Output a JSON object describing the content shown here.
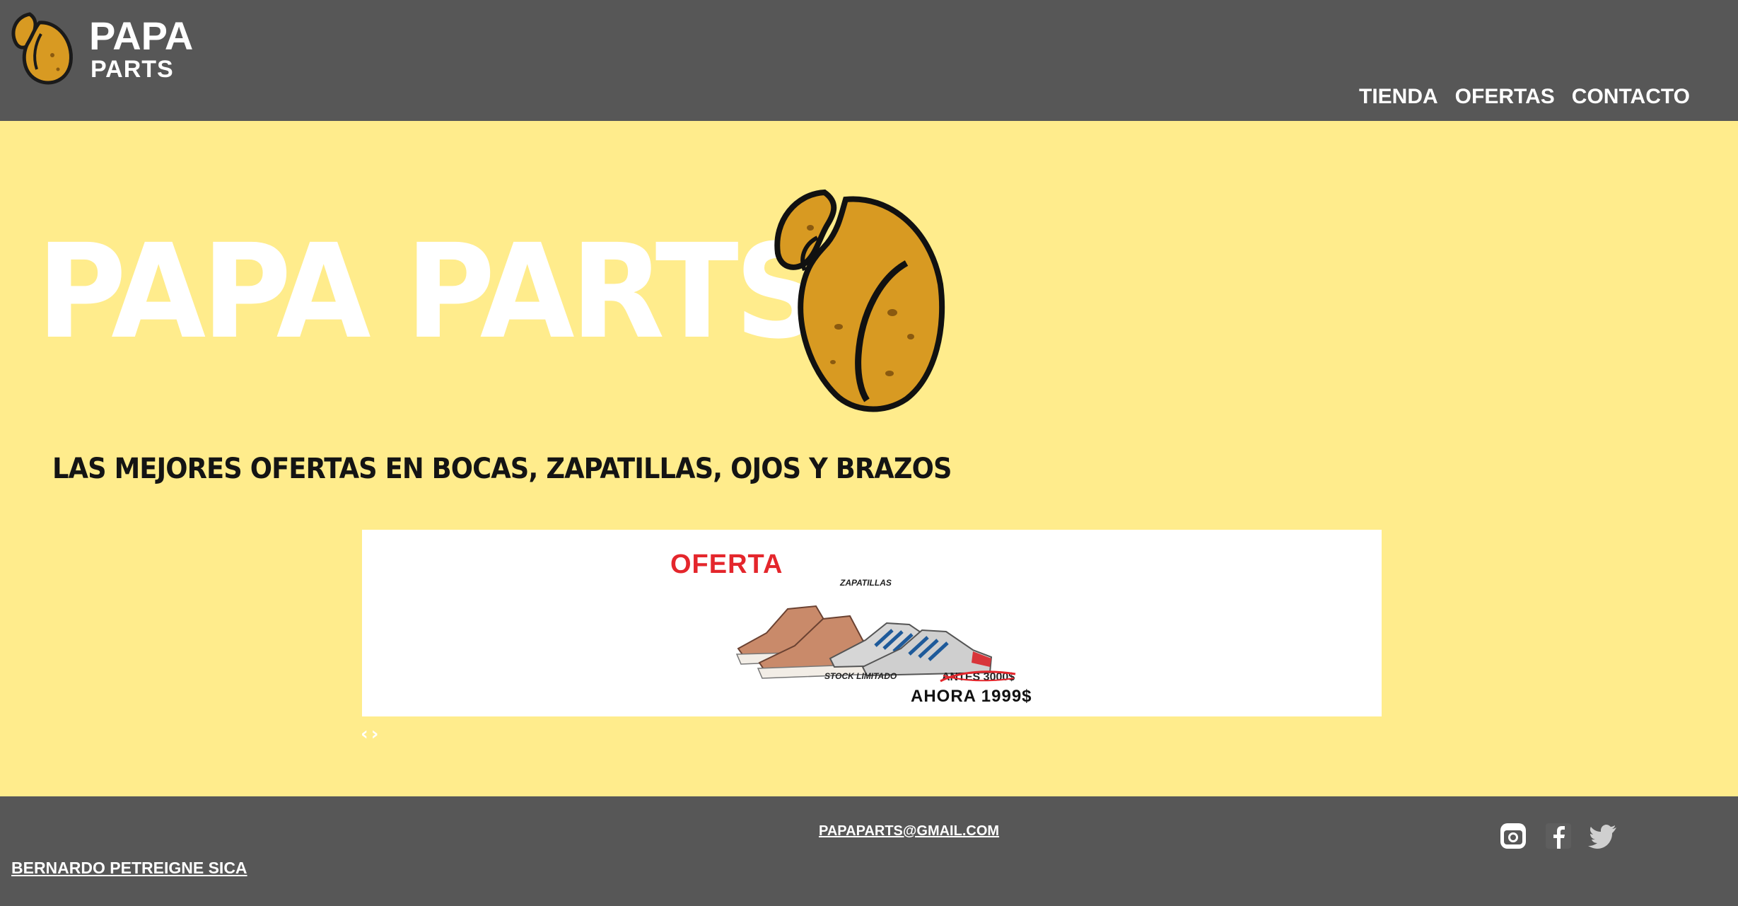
{
  "header": {
    "brand_line1": "PAPA",
    "brand_line2": "PARTS",
    "logo_icon": "potato-logo-icon",
    "nav": [
      {
        "label": "TIENDA"
      },
      {
        "label": "OFERTAS"
      },
      {
        "label": "CONTACTO"
      }
    ]
  },
  "hero": {
    "title": "PAPA PARTS",
    "image_icon": "potato-illustration",
    "tagline": "LAS MEJORES OFERTAS EN BOCAS, ZAPATILLAS, OJOS Y BRAZOS"
  },
  "banner": {
    "label": "OFERTA",
    "product": "ZAPATILLAS",
    "stock": "STOCK LIMITADO",
    "old_price": "ANTES 3000$",
    "new_price": "AHORA  1999$"
  },
  "carousel": {
    "prev_icon": "chevron-left-icon",
    "next_icon": "chevron-right-icon",
    "prev_glyph": "‹",
    "next_glyph": "›"
  },
  "footer": {
    "email": "PAPAPARTS@GMAIL.COM",
    "author": "BERNARDO PETREIGNE SICA",
    "social": [
      "instagram-icon",
      "facebook-icon",
      "twitter-icon"
    ]
  },
  "colors": {
    "header_bg": "#575757",
    "page_bg": "#ffec8c",
    "potato": "#d89a22",
    "accent_red": "#e4262c"
  }
}
